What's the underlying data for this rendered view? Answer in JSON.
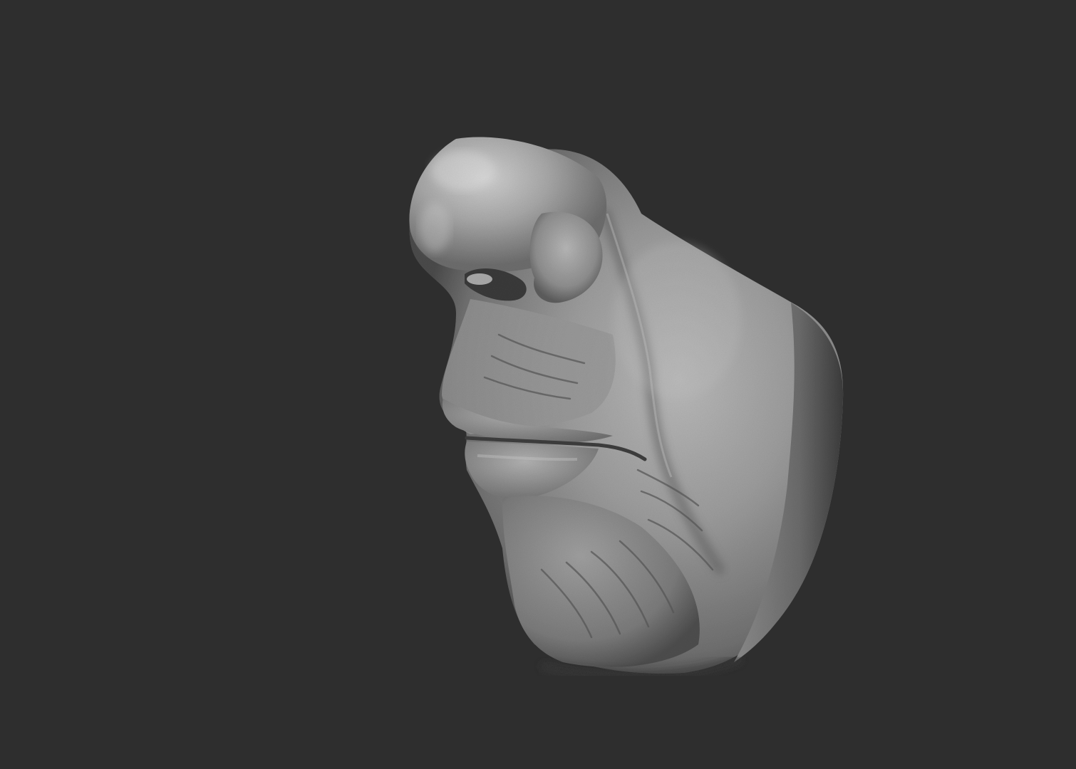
{
  "scene": {
    "background_color": "#2e2e2e",
    "subject": "sculpt-nose-mouth",
    "material_base_color": "#8c8c8c",
    "material_highlight_color": "#c9c9c9",
    "material_shadow_color": "#3a3a3a"
  }
}
